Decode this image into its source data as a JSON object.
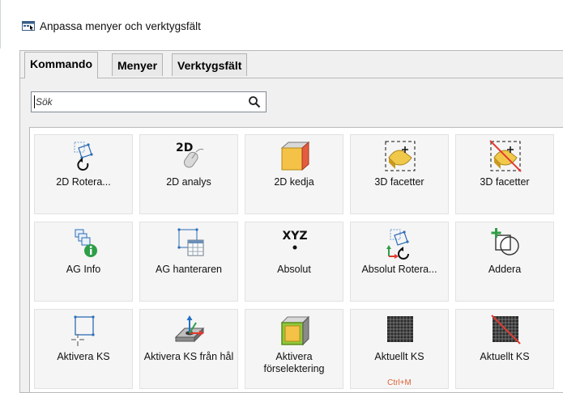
{
  "window": {
    "title": "Anpassa menyer och verktygsfält"
  },
  "tabs": [
    {
      "label": "Kommando",
      "active": true
    },
    {
      "label": "Menyer",
      "active": false
    },
    {
      "label": "Verktygsfält",
      "active": false
    }
  ],
  "search": {
    "placeholder": "Sök",
    "value": ""
  },
  "commands": [
    {
      "label": "2D Rotera...",
      "icon": "2d-rotate-icon"
    },
    {
      "label": "2D analys",
      "icon": "2d-analysis-mouse-icon"
    },
    {
      "label": "2D kedja",
      "icon": "2d-chain-box-icon"
    },
    {
      "label": "3D facetter",
      "icon": "3d-facets-icon"
    },
    {
      "label": "3D facetter",
      "icon": "3d-facets-remove-icon"
    },
    {
      "label": "AG Info",
      "icon": "ag-info-icon"
    },
    {
      "label": "AG hanteraren",
      "icon": "ag-manager-icon"
    },
    {
      "label": "Absolut",
      "icon": "xyz-absolute-icon",
      "icon_text": "XYZ"
    },
    {
      "label": "Absolut Rotera...",
      "icon": "absolute-rotate-icon"
    },
    {
      "label": "Addera",
      "icon": "add-shape-icon"
    },
    {
      "label": "Aktivera KS",
      "icon": "activate-cs-icon"
    },
    {
      "label": "Aktivera KS från hål",
      "icon": "activate-cs-from-hole-icon"
    },
    {
      "label": "Aktivera förselektering",
      "icon": "activate-preselection-icon"
    },
    {
      "label": "Aktuellt KS",
      "icon": "current-cs-grid-icon",
      "shortcut": "Ctrl+M"
    },
    {
      "label": "Aktuellt KS",
      "icon": "current-cs-grid-remove-icon"
    }
  ],
  "colors": {
    "accent_blue": "#1f6fc5",
    "shortcut": "#e0623a",
    "tile_bg": "#f5f5f5",
    "add_green": "#2ea043"
  }
}
